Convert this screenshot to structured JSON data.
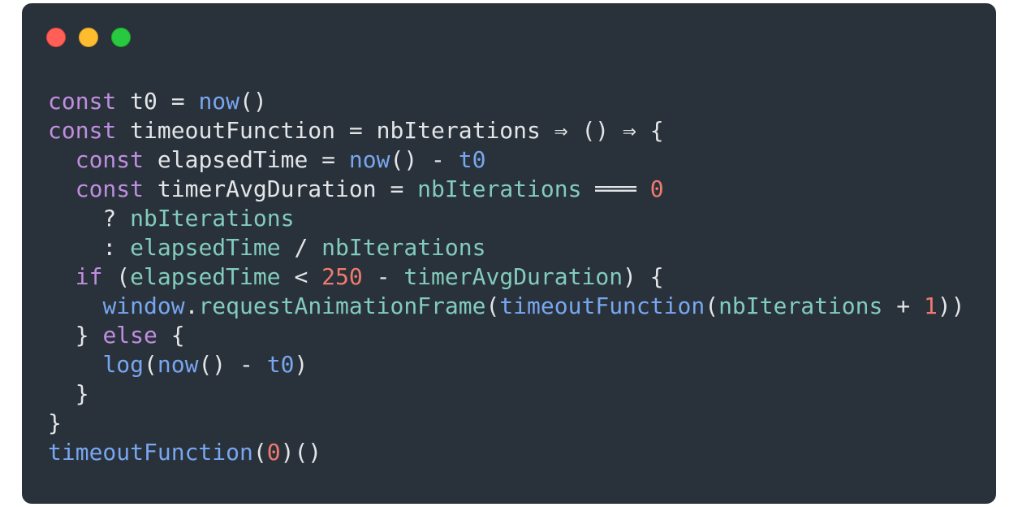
{
  "window": {
    "traffic_lights": [
      {
        "name": "close",
        "color": "#ff5f57"
      },
      {
        "name": "minimize",
        "color": "#febc2e"
      },
      {
        "name": "maximize",
        "color": "#28c840"
      }
    ]
  },
  "theme": {
    "background": "#29323a",
    "text": "#e3e5e8",
    "keyword": "#c08ee0",
    "function": "#78a6f0",
    "variable": "#82cbbd",
    "number": "#f07a6e"
  },
  "code": {
    "language": "javascript",
    "lines": [
      [
        {
          "t": "kw",
          "v": "const"
        },
        {
          "t": "op",
          "v": " t0 = "
        },
        {
          "t": "fn",
          "v": "now"
        },
        {
          "t": "op",
          "v": "()"
        }
      ],
      [
        {
          "t": "kw",
          "v": "const"
        },
        {
          "t": "op",
          "v": " timeoutFunction = nbIterations ⇒ () ⇒ {"
        }
      ],
      [
        {
          "t": "op",
          "v": "  "
        },
        {
          "t": "kw",
          "v": "const"
        },
        {
          "t": "op",
          "v": " elapsedTime = "
        },
        {
          "t": "fn",
          "v": "now"
        },
        {
          "t": "op",
          "v": "() - "
        },
        {
          "t": "fn",
          "v": "t0"
        }
      ],
      [
        {
          "t": "op",
          "v": "  "
        },
        {
          "t": "kw",
          "v": "const"
        },
        {
          "t": "op",
          "v": " timerAvgDuration = "
        },
        {
          "t": "var",
          "v": "nbIterations"
        },
        {
          "t": "op",
          "v": " ═══ "
        },
        {
          "t": "num",
          "v": "0"
        }
      ],
      [
        {
          "t": "op",
          "v": "    ? "
        },
        {
          "t": "var",
          "v": "nbIterations"
        }
      ],
      [
        {
          "t": "op",
          "v": "    : "
        },
        {
          "t": "var",
          "v": "elapsedTime"
        },
        {
          "t": "op",
          "v": " / "
        },
        {
          "t": "var",
          "v": "nbIterations"
        }
      ],
      [
        {
          "t": "op",
          "v": "  "
        },
        {
          "t": "kw",
          "v": "if"
        },
        {
          "t": "op",
          "v": " ("
        },
        {
          "t": "var",
          "v": "elapsedTime"
        },
        {
          "t": "op",
          "v": " < "
        },
        {
          "t": "num",
          "v": "250"
        },
        {
          "t": "op",
          "v": " - "
        },
        {
          "t": "var",
          "v": "timerAvgDuration"
        },
        {
          "t": "op",
          "v": ") {"
        }
      ],
      [
        {
          "t": "op",
          "v": "    "
        },
        {
          "t": "fn",
          "v": "window"
        },
        {
          "t": "op",
          "v": "."
        },
        {
          "t": "prop",
          "v": "requestAnimationFrame"
        },
        {
          "t": "op",
          "v": "("
        },
        {
          "t": "fn",
          "v": "timeoutFunction"
        },
        {
          "t": "op",
          "v": "("
        },
        {
          "t": "var",
          "v": "nbIterations"
        },
        {
          "t": "op",
          "v": " + "
        },
        {
          "t": "num",
          "v": "1"
        },
        {
          "t": "op",
          "v": "))"
        }
      ],
      [
        {
          "t": "op",
          "v": "  } "
        },
        {
          "t": "kw",
          "v": "else"
        },
        {
          "t": "op",
          "v": " {"
        }
      ],
      [
        {
          "t": "op",
          "v": "    "
        },
        {
          "t": "fn",
          "v": "log"
        },
        {
          "t": "op",
          "v": "("
        },
        {
          "t": "fn",
          "v": "now"
        },
        {
          "t": "op",
          "v": "() - "
        },
        {
          "t": "fn",
          "v": "t0"
        },
        {
          "t": "op",
          "v": ")"
        }
      ],
      [
        {
          "t": "op",
          "v": "  }"
        }
      ],
      [
        {
          "t": "op",
          "v": "}"
        }
      ],
      [
        {
          "t": "fn",
          "v": "timeoutFunction"
        },
        {
          "t": "op",
          "v": "("
        },
        {
          "t": "num",
          "v": "0"
        },
        {
          "t": "op",
          "v": ")()"
        }
      ]
    ]
  }
}
